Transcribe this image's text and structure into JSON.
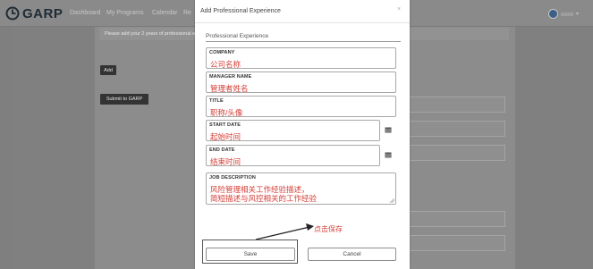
{
  "header": {
    "logo_text": "GARP",
    "nav": [
      "Dashboard",
      "My Programs",
      "Calendar",
      "Re"
    ],
    "user_name": "",
    "user_caret": "▾"
  },
  "main": {
    "notice": "Please add your 2 years of professional experience...",
    "add_label": "Add",
    "submit_label": "Submit to GARP"
  },
  "modal": {
    "title": "Add Professional Experience",
    "close": "×",
    "section_title": "Professional Experience",
    "fields": {
      "company": {
        "label": "COMPANY",
        "value": "公司名称"
      },
      "manager": {
        "label": "MANAGER NAME",
        "value": "管理者姓名"
      },
      "title": {
        "label": "TITLE",
        "value": "职称/头像"
      },
      "start_date": {
        "label": "START DATE",
        "value": "起始时间"
      },
      "end_date": {
        "label": "END DATE",
        "value": "结束时间"
      },
      "job_description": {
        "label": "JOB DESCRIPTION",
        "line1": "风险管理相关工作经验描述，",
        "line2": "简短描述与风控相关的工作经验"
      }
    },
    "annotation": "点击保存",
    "save_label": "Save",
    "cancel_label": "Cancel"
  },
  "colors": {
    "annotation_red": "#d43d35",
    "overlay_gray": "#8c8c8c",
    "brand_dark": "#1f2b36"
  },
  "icons": [
    "garp-logo-icon",
    "calendar-icon",
    "close-icon",
    "user-avatar-icon",
    "chevron-down-icon",
    "annotation-arrow-icon"
  ]
}
